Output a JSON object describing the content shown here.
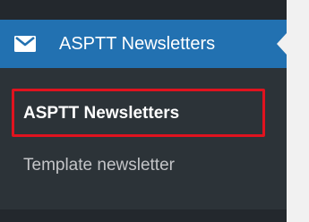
{
  "menu": {
    "icon": "envelope-icon",
    "title": "ASPTT Newsletters",
    "header_color": "#2271b1",
    "background_color": "#23282d"
  },
  "submenu": {
    "items": [
      {
        "label": "ASPTT Newsletters",
        "current": true
      },
      {
        "label": "Template newsletter",
        "current": false
      }
    ]
  },
  "annotation": {
    "highlight_color": "#e0131f"
  }
}
